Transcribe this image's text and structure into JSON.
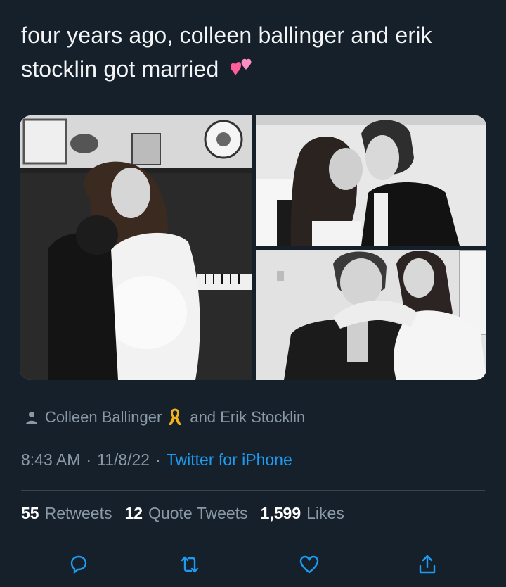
{
  "tweet": {
    "text": "four years ago, colleen ballinger and erik stocklin got married",
    "emoji_icon": "two-hearts-icon"
  },
  "media": {
    "photo_count": 3
  },
  "tagged": {
    "icon": "person-icon",
    "name_1": "Colleen Ballinger",
    "ribbon_icon": "ribbon-icon",
    "connector": "and",
    "name_2": "Erik Stocklin"
  },
  "meta": {
    "time": "8:43 AM",
    "separator": "·",
    "date": "11/8/22",
    "source": "Twitter for iPhone"
  },
  "stats": {
    "retweets_count": "55",
    "retweets_label": "Retweets",
    "quotes_count": "12",
    "quotes_label": "Quote Tweets",
    "likes_count": "1,599",
    "likes_label": "Likes"
  },
  "actions": [
    "reply-icon",
    "retweet-icon",
    "like-icon",
    "share-icon"
  ],
  "colors": {
    "background": "#15202b",
    "text": "#ffffff",
    "secondary": "#8b98a5",
    "link": "#1d9bf0",
    "divider": "#38444d",
    "emoji": "#ff5c9a"
  }
}
